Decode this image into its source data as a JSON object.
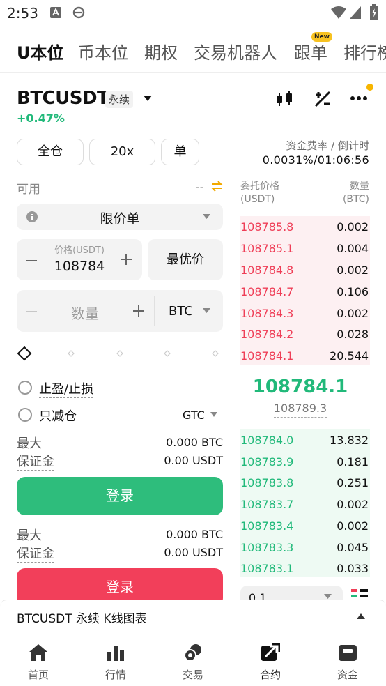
{
  "status_bar": {
    "time": "2:53"
  },
  "tabs": [
    {
      "label": "U本位",
      "active": true
    },
    {
      "label": "币本位"
    },
    {
      "label": "期权"
    },
    {
      "label": "交易机器人"
    },
    {
      "label": "跟单",
      "badge": "New"
    },
    {
      "label": "排行榜"
    }
  ],
  "contract": {
    "symbol": "BTCUSDT",
    "type": "永续",
    "change": "+0.47%"
  },
  "controls": {
    "margin_mode": "全仓",
    "leverage": "20x",
    "position_mode": "单"
  },
  "funding": {
    "label": "资金费率 / 倒计时",
    "value": "0.0031%/01:06:56"
  },
  "available": {
    "label": "可用",
    "value": "--"
  },
  "order_type": "限价单",
  "price_input": {
    "label": "价格(USDT)",
    "value": "108784",
    "best_price_label": "最优价"
  },
  "quantity_input": {
    "placeholder": "数量",
    "unit": "BTC"
  },
  "options": {
    "tp_sl": "止盈/止损",
    "reduce_only": "只减仓",
    "time_in_force": "GTC"
  },
  "buy_info": {
    "max_label": "最大",
    "max_value": "0.000 BTC",
    "margin_label": "保证金",
    "margin_value": "0.00 USDT"
  },
  "sell_info": {
    "max_label": "最大",
    "max_value": "0.000 BTC",
    "margin_label": "保证金",
    "margin_value": "0.00 USDT"
  },
  "buttons": {
    "login_buy": "登录",
    "login_sell": "登录"
  },
  "orderbook": {
    "price_header": "委托价格",
    "price_unit": "(USDT)",
    "qty_header": "数量",
    "qty_unit": "(BTC)",
    "asks": [
      {
        "price": "108785.8",
        "qty": "0.002"
      },
      {
        "price": "108785.1",
        "qty": "0.004"
      },
      {
        "price": "108784.8",
        "qty": "0.002"
      },
      {
        "price": "108784.7",
        "qty": "0.106"
      },
      {
        "price": "108784.3",
        "qty": "0.002"
      },
      {
        "price": "108784.2",
        "qty": "0.028"
      },
      {
        "price": "108784.1",
        "qty": "20.544"
      }
    ],
    "last_price": "108784.1",
    "mark_price": "108789.3",
    "bids": [
      {
        "price": "108784.0",
        "qty": "13.832"
      },
      {
        "price": "108783.9",
        "qty": "0.181"
      },
      {
        "price": "108783.8",
        "qty": "0.251"
      },
      {
        "price": "108783.7",
        "qty": "0.002"
      },
      {
        "price": "108783.4",
        "qty": "0.002"
      },
      {
        "price": "108783.3",
        "qty": "0.045"
      },
      {
        "price": "108783.1",
        "qty": "0.033"
      }
    ],
    "depth_step": "0.1"
  },
  "chart_bar": {
    "title": "BTCUSDT 永续 K线图表"
  },
  "bottom_nav": [
    {
      "label": "首页",
      "icon": "home-icon"
    },
    {
      "label": "行情",
      "icon": "bar-chart-icon"
    },
    {
      "label": "交易",
      "icon": "trade-coins-icon"
    },
    {
      "label": "合约",
      "icon": "futures-icon",
      "active": true
    },
    {
      "label": "资金",
      "icon": "wallet-icon"
    }
  ],
  "colors": {
    "buy": "#21b97a",
    "sell": "#ef3e57",
    "accent": "#f7c221"
  }
}
